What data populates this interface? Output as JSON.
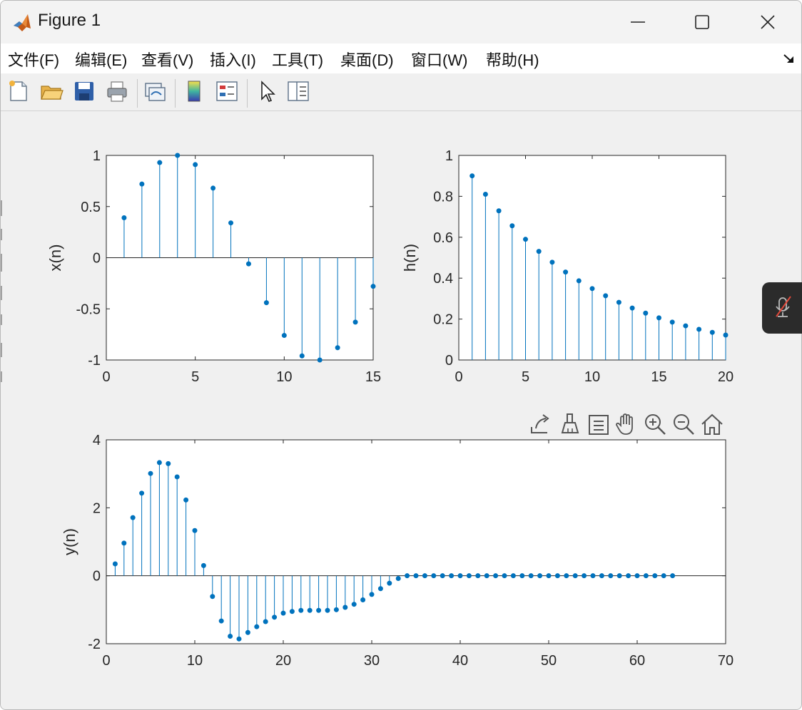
{
  "window": {
    "title": "Figure 1",
    "controls": {
      "minimize": "minimize-icon",
      "maximize": "maximize-icon",
      "close": "close-icon"
    }
  },
  "menu": {
    "items": [
      {
        "label": "文件(F)"
      },
      {
        "label": "编辑(E)"
      },
      {
        "label": "查看(V)"
      },
      {
        "label": "插入(I)"
      },
      {
        "label": "工具(T)"
      },
      {
        "label": "桌面(D)"
      },
      {
        "label": "窗口(W)"
      },
      {
        "label": "帮助(H)"
      }
    ],
    "overflow_icon": "dock-arrow-icon"
  },
  "toolbar": {
    "icons": [
      "new-figure-icon",
      "open-file-icon",
      "save-icon",
      "print-icon",
      "link-plot-icon",
      "colorbar-icon",
      "legend-icon",
      "select-pointer-icon",
      "property-inspector-icon"
    ]
  },
  "axes_toolbar": {
    "icons": [
      "export-icon",
      "brush-icon",
      "datatip-icon",
      "pan-icon",
      "zoom-in-icon",
      "zoom-out-icon",
      "restore-view-icon"
    ]
  },
  "colors": {
    "stem": "#0072bd",
    "axis": "#262626",
    "background": "#f0f0f0",
    "plot_bg": "#ffffff"
  },
  "chart_data": [
    {
      "type": "stem",
      "ylabel": "x(n)",
      "xlim": [
        0,
        15
      ],
      "ylim": [
        -1,
        1
      ],
      "xticks": [
        "0",
        "5",
        "10",
        "15"
      ],
      "yticks": [
        "1",
        "0.5",
        "0",
        "-0.5",
        "-1"
      ],
      "x": [
        1,
        2,
        3,
        4,
        5,
        6,
        7,
        8,
        9,
        10,
        11,
        12,
        13,
        14,
        15
      ],
      "y": [
        0.39,
        0.72,
        0.93,
        1.0,
        0.91,
        0.68,
        0.34,
        -0.06,
        -0.44,
        -0.76,
        -0.96,
        -1.0,
        -0.88,
        -0.63,
        -0.28
      ]
    },
    {
      "type": "stem",
      "ylabel": "h(n)",
      "xlim": [
        0,
        20
      ],
      "ylim": [
        0,
        1
      ],
      "xticks": [
        "0",
        "5",
        "10",
        "15",
        "20"
      ],
      "yticks": [
        "1",
        "0.8",
        "0.6",
        "0.4",
        "0.2",
        "0"
      ],
      "x": [
        1,
        2,
        3,
        4,
        5,
        6,
        7,
        8,
        9,
        10,
        11,
        12,
        13,
        14,
        15,
        16,
        17,
        18,
        19,
        20
      ],
      "y": [
        0.9,
        0.81,
        0.729,
        0.656,
        0.59,
        0.531,
        0.478,
        0.43,
        0.387,
        0.349,
        0.314,
        0.282,
        0.254,
        0.229,
        0.206,
        0.185,
        0.167,
        0.15,
        0.135,
        0.122
      ]
    },
    {
      "type": "stem",
      "ylabel": "y(n)",
      "xlim": [
        0,
        70
      ],
      "ylim": [
        -2,
        4
      ],
      "xticks": [
        "0",
        "10",
        "20",
        "30",
        "40",
        "50",
        "60",
        "70"
      ],
      "yticks": [
        "4",
        "2",
        "0",
        "-2"
      ],
      "x": [
        1,
        2,
        3,
        4,
        5,
        6,
        7,
        8,
        9,
        10,
        11,
        12,
        13,
        14,
        15,
        16,
        17,
        18,
        19,
        20,
        21,
        22,
        23,
        24,
        25,
        26,
        27,
        28,
        29,
        30,
        31,
        32,
        33,
        34,
        35,
        36,
        37,
        38,
        39,
        40,
        41,
        42,
        43,
        44,
        45,
        46,
        47,
        48,
        49,
        50,
        51,
        52,
        53,
        54,
        55,
        56,
        57,
        58,
        59,
        60,
        61,
        62,
        63,
        64
      ],
      "y": [
        0.35,
        0.96,
        1.71,
        2.43,
        3.01,
        3.33,
        3.3,
        2.91,
        2.23,
        1.33,
        0.3,
        -0.61,
        -1.33,
        -1.78,
        -1.86,
        -1.67,
        -1.5,
        -1.35,
        -1.22,
        -1.1,
        -1.05,
        -1.02,
        -1.02,
        -1.02,
        -1.02,
        -1.0,
        -0.93,
        -0.84,
        -0.71,
        -0.55,
        -0.38,
        -0.22,
        -0.08,
        0,
        0,
        0,
        0,
        0,
        0,
        0,
        0,
        0,
        0,
        0,
        0,
        0,
        0,
        0,
        0,
        0,
        0,
        0,
        0,
        0,
        0,
        0,
        0,
        0,
        0,
        0,
        0,
        0,
        0,
        0
      ]
    }
  ]
}
